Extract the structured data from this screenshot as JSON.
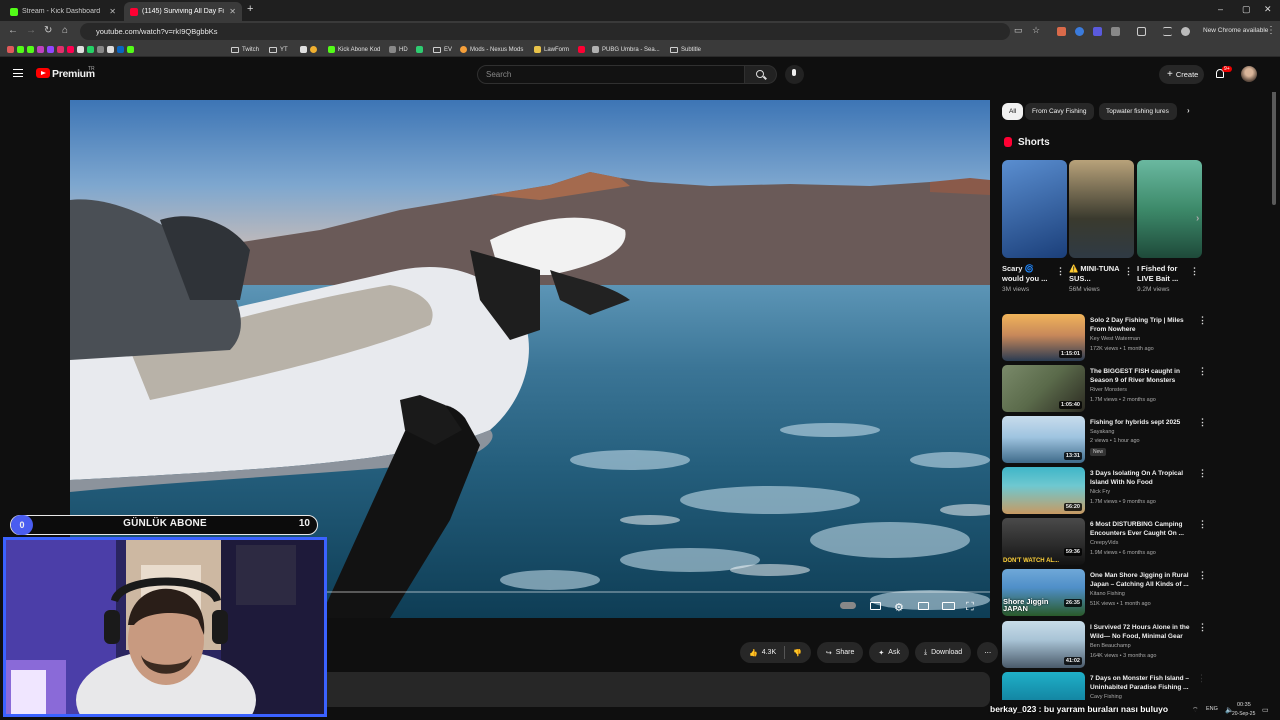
{
  "browser": {
    "tabs": [
      {
        "title": "Stream - Kick Dashboard",
        "favicon_color": "#53fc18"
      },
      {
        "title": "(1145) Surviving All Day Fi",
        "favicon_color": "#ff0033"
      }
    ],
    "new_tab": "+",
    "window_controls": [
      "–",
      "▢",
      "✕"
    ],
    "url": "youtube.com/watch?v=rkI9QBgbbKs",
    "update_label": "New Chrome available",
    "bookmarks": [
      {
        "label": "Twitch",
        "type": "folder"
      },
      {
        "label": "YT",
        "type": "folder"
      },
      {
        "label": "Kick Abone Kod",
        "type": "link",
        "color": "#53fc18"
      },
      {
        "label": "HD",
        "type": "link",
        "color": "#888"
      },
      {
        "label": "EV",
        "type": "folder"
      },
      {
        "label": "Mods - Nexus Mods",
        "type": "link",
        "color": "#f59f3a"
      },
      {
        "label": "LawForm",
        "type": "link",
        "color": "#e8c34a"
      },
      {
        "label": "PUBG Umbra - Sea...",
        "type": "link",
        "color": "#b0b0b0"
      },
      {
        "label": "Subtitle",
        "type": "folder"
      }
    ]
  },
  "youtube": {
    "brand": "Premium",
    "region": "TR",
    "search_placeholder": "Search",
    "create_label": "Create",
    "notification_badge": "9+"
  },
  "player": {
    "progress": 0.0,
    "controls": [
      "autoplay-toggle",
      "subtitles",
      "settings",
      "miniplayer",
      "theater",
      "fullscreen"
    ]
  },
  "actions": {
    "likes": "4.3K",
    "share": "Share",
    "ask": "Ask",
    "download": "Download",
    "more": "⋯"
  },
  "filter_chips": [
    "All",
    "From Cavy Fishing",
    "Topwater fishing lures"
  ],
  "shorts": {
    "heading": "Shorts",
    "items": [
      {
        "title": "Scary 🌀 would you ...",
        "views": "3M views",
        "colors": [
          "#2a6ab8",
          "#1b3f7a"
        ]
      },
      {
        "title": "⚠️ MINI-TUNA SUS...",
        "views": "56M views",
        "colors": [
          "#7a6a4e",
          "#2f3a44"
        ]
      },
      {
        "title": "I Fished for LIVE Bait ...",
        "views": "9.2M views",
        "colors": [
          "#3d8a6a",
          "#1e4a3a"
        ]
      }
    ]
  },
  "recommendations": [
    {
      "title": "Solo 2 Day Fishing Trip | Miles From Nowhere",
      "channel": "Key West Waterman",
      "meta": "172K views • 1 month ago",
      "duration": "1:15:01",
      "colors": [
        "#f0b45a",
        "#2a3b52"
      ]
    },
    {
      "title": "The BIGGEST FISH caught in Season 9 of River Monsters",
      "channel": "River Monsters",
      "meta": "1.7M views • 2 months ago",
      "duration": "1:05:40",
      "colors": [
        "#5a6a4a",
        "#2c2a22"
      ]
    },
    {
      "title": "Fishing for hybrids sept 2025",
      "channel": "Sayakang",
      "meta": "2 views • 1 hour ago",
      "duration": "13:31",
      "badge": "New",
      "colors": [
        "#9fc4e0",
        "#3f6b8a"
      ]
    },
    {
      "title": "3 Days Isolating On A Tropical Island With No Food",
      "channel": "Nick Fry",
      "meta": "1.7M views • 9 months ago",
      "duration": "56:20",
      "colors": [
        "#3fb6c8",
        "#c89a62"
      ]
    },
    {
      "title": "6 Most DISTURBING Camping Encounters Ever Caught On ...",
      "channel": "CreepyVids",
      "meta": "1.9M views • 6 months ago",
      "duration": "59:36",
      "overlay": "DON'T WATCH AL...",
      "colors": [
        "#3a3a3a",
        "#121212"
      ]
    },
    {
      "title": "One Man Shore Jigging in Rural Japan – Catching All Kinds of ...",
      "channel": "Kitano Fishing",
      "meta": "51K views • 1 month ago",
      "duration": "26:35",
      "overlay": "Shore Jiggin JAPAN",
      "colors": [
        "#4f8fc8",
        "#2a5a2a"
      ]
    },
    {
      "title": "I Survived 72 Hours Alone in the Wild— No Food, Minimal Gear",
      "channel": "Ben Beauchamp",
      "meta": "164K views • 3 months ago",
      "duration": "41:02",
      "colors": [
        "#a9c4d6",
        "#4a5a6a"
      ]
    },
    {
      "title": "7 Days on Monster Fish Island – Uninhabited Paradise Fishing ...",
      "channel": "Cavy Fishing",
      "meta": "",
      "duration": "",
      "colors": [
        "#1fb0c8",
        "#0c6a8a"
      ]
    }
  ],
  "stream_overlay": {
    "sub_label": "GÜNLÜK ABONE",
    "sub_current": "0",
    "sub_goal": "10",
    "chat_message": "berkay_023 : bu yarram buraları nası buluyo"
  },
  "taskbar": {
    "lang": "ENG",
    "time": "00:35",
    "date": "20-Sep-25"
  }
}
